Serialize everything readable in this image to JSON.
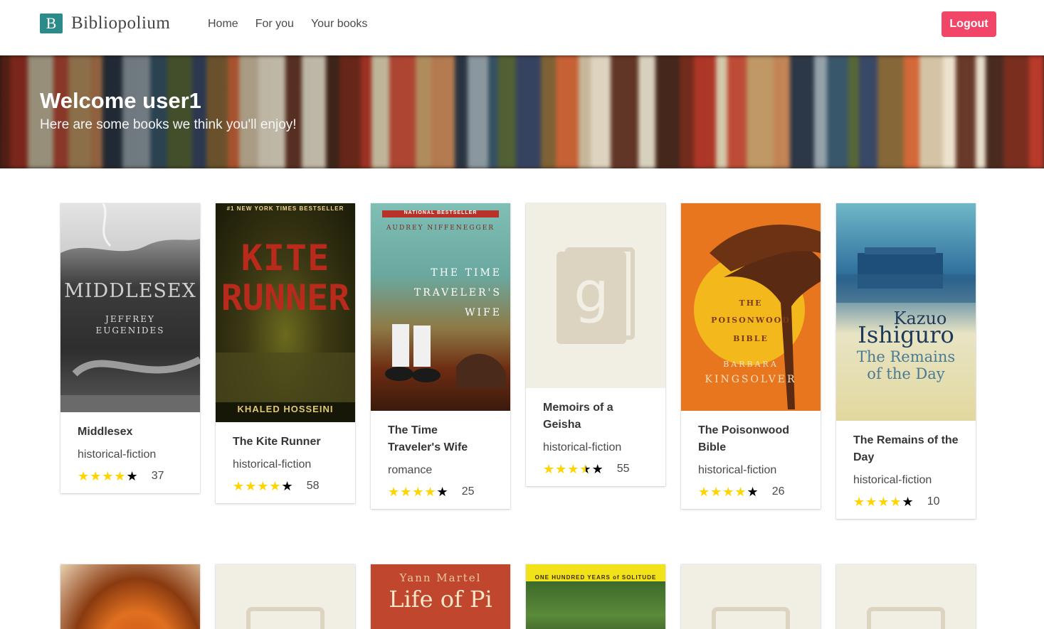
{
  "app": {
    "brand_letter": "B",
    "brand_name": "Bibliopolium"
  },
  "nav": {
    "links": [
      "Home",
      "For you",
      "Your books"
    ],
    "logout_label": "Logout"
  },
  "colors": {
    "brand": "#2b8a8a",
    "logout": "#f14668",
    "star": "#ffd400"
  },
  "hero": {
    "title": "Welcome user1",
    "subtitle": "Here are some books we think you'll enjoy!"
  },
  "books": [
    {
      "title": "Middlesex",
      "genre": "historical-fiction",
      "rating": 4,
      "max_rating": 5,
      "count": "37",
      "cover_text": [
        "MIDDLESEX",
        "JEFFREY",
        "EUGENIDES"
      ]
    },
    {
      "title": "The Kite Runner",
      "genre": "historical-fiction",
      "rating": 4,
      "max_rating": 5,
      "count": "58",
      "cover_text": [
        "#1 NEW YORK TIMES BESTSELLER",
        "KITE",
        "RUNNER",
        "KHALED HOSSEINI"
      ]
    },
    {
      "title": "The Time Traveler's Wife",
      "genre": "romance",
      "rating": 4,
      "max_rating": 5,
      "count": "25",
      "cover_text": [
        "NATIONAL BESTSELLER",
        "AUDREY NIFFENEGGER",
        "THE TIME",
        "TRAVELER'S",
        "WIFE"
      ]
    },
    {
      "title": "Memoirs of a Geisha",
      "genre": "historical-fiction",
      "rating": 3.5,
      "max_rating": 5,
      "count": "55",
      "cover_text": []
    },
    {
      "title": "The Poisonwood Bible",
      "genre": "historical-fiction",
      "rating": 4,
      "max_rating": 5,
      "count": "26",
      "cover_text": [
        "THE",
        "POISONWOOD",
        "BIBLE",
        "BARBARA",
        "KINGSOLVER"
      ]
    },
    {
      "title": "The Remains of the Day",
      "genre": "historical-fiction",
      "rating": 4,
      "max_rating": 5,
      "count": "10",
      "cover_text": [
        "Kazuo",
        "Ishiguro",
        "The Remains",
        "of the Day"
      ]
    }
  ],
  "second_row": [
    {
      "cover_text": []
    },
    {
      "cover_text": []
    },
    {
      "cover_text": [
        "Yann Martel",
        "Life of Pi"
      ]
    },
    {
      "cover_text": [
        "ONE HUNDRED YEARS of SOLITUDE"
      ]
    },
    {
      "cover_text": []
    },
    {
      "cover_text": []
    }
  ]
}
